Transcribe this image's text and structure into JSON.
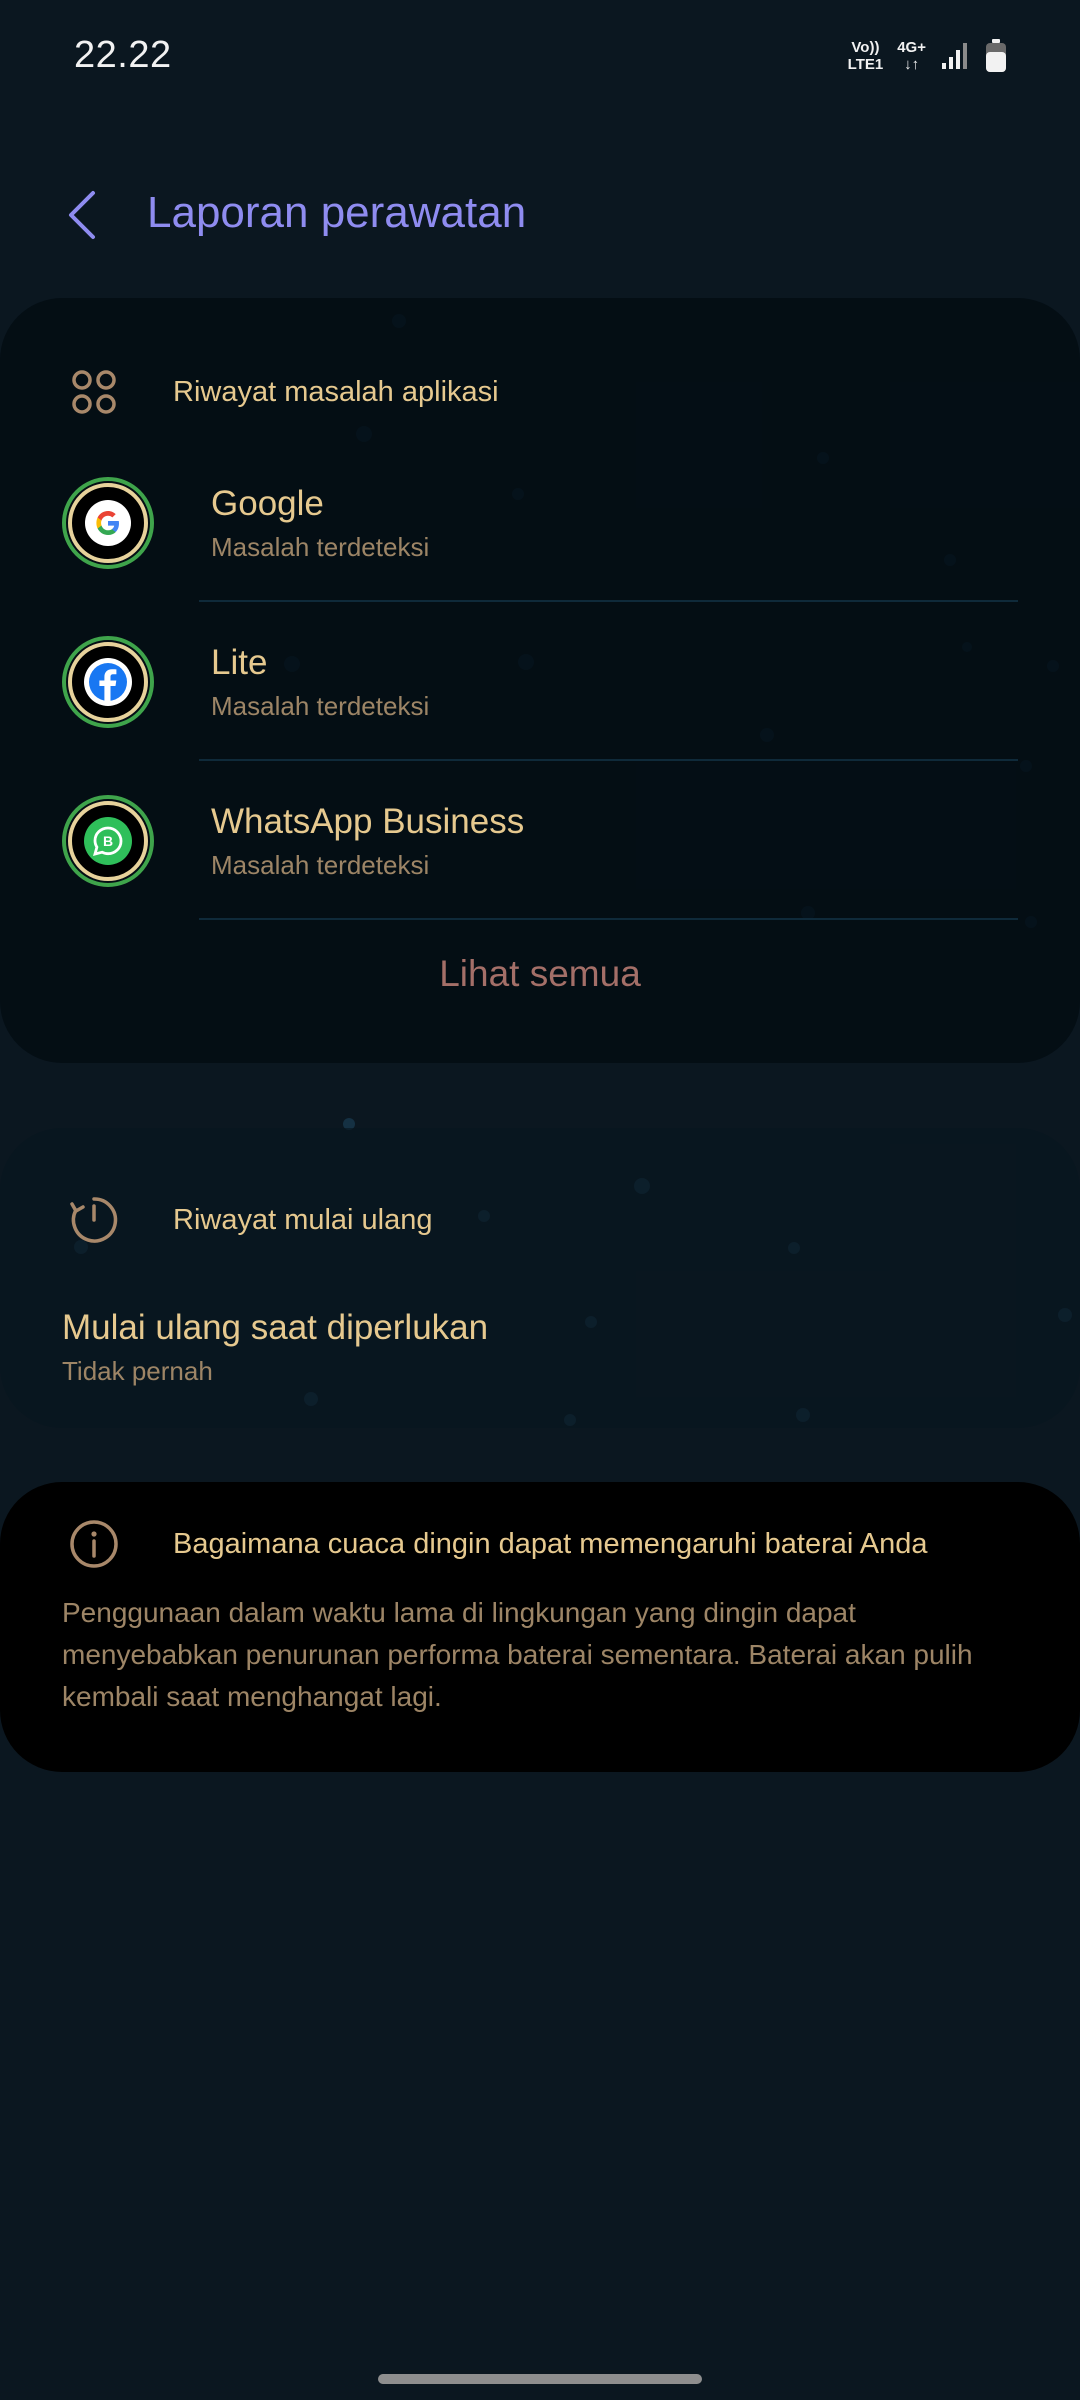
{
  "status_bar": {
    "time": "22.22",
    "volte_top": "Vo))",
    "volte_bottom": "LTE1",
    "network_top": "4G+",
    "network_bottom": "↓↑"
  },
  "header": {
    "title": "Laporan perawatan",
    "back_icon": "chevron-left-icon"
  },
  "app_issues": {
    "section_label": "Riwayat masalah aplikasi",
    "section_icon": "apps-grid-icon",
    "items": [
      {
        "name": "Google",
        "status": "Masalah terdeteksi",
        "icon": "google-icon"
      },
      {
        "name": "Lite",
        "status": "Masalah terdeteksi",
        "icon": "facebook-icon"
      },
      {
        "name": "WhatsApp Business",
        "status": "Masalah terdeteksi",
        "icon": "whatsapp-business-icon"
      }
    ],
    "see_all_label": "Lihat semua"
  },
  "restart_history": {
    "section_label": "Riwayat mulai ulang",
    "section_icon": "restart-icon",
    "title": "Mulai ulang saat diperlukan",
    "value": "Tidak pernah"
  },
  "info": {
    "title": "Bagaimana cuaca dingin dapat memengaruhi baterai Anda",
    "icon": "info-icon",
    "body": "Penggunaan dalam waktu lama di lingkungan yang dingin dapat menyebabkan penurunan performa baterai sementara. Baterai akan pulih kembali saat menghangat lagi."
  },
  "colors": {
    "background": "#0b1720",
    "title_accent": "#8f8cf0",
    "text_primary": "#e6c98f",
    "text_secondary": "#9d8566",
    "see_all": "#a46f68",
    "icon_ring": "#3fa44b"
  }
}
